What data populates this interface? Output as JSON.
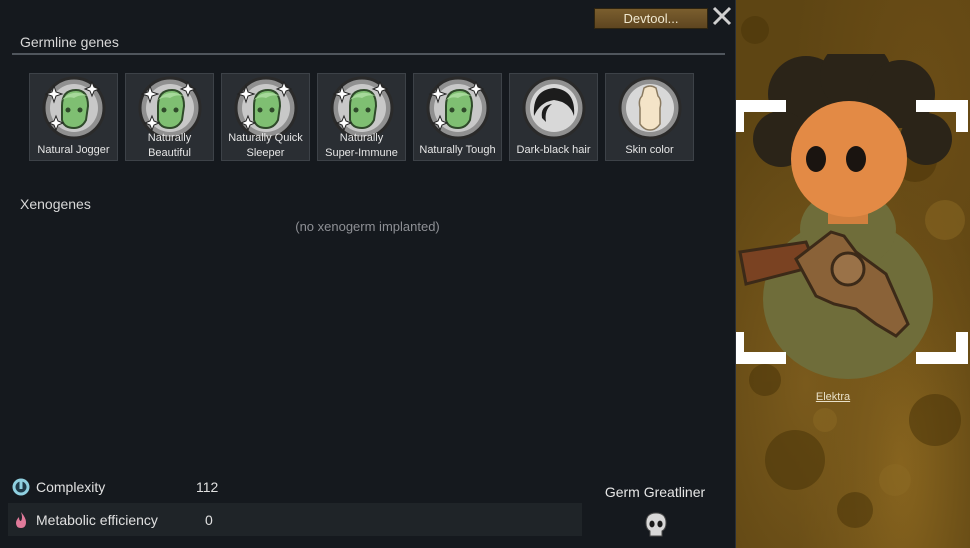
{
  "window": {
    "devtool_label": "Devtool...",
    "germline_title": "Germline genes",
    "xenogenes_title": "Xenogenes",
    "xenogenes_empty": "(no xenogerm implanted)"
  },
  "genes": [
    {
      "label": "Natural Jogger",
      "icon": "gene-head-icon"
    },
    {
      "label": "Naturally\nBeautiful",
      "icon": "gene-head-icon"
    },
    {
      "label": "Naturally Quick\nSleeper",
      "icon": "gene-head-icon"
    },
    {
      "label": "Naturally\nSuper-Immune",
      "icon": "gene-head-icon"
    },
    {
      "label": "Naturally Tough",
      "icon": "gene-head-icon"
    },
    {
      "label": "Dark-black hair",
      "icon": "hair-icon"
    },
    {
      "label": "Skin color",
      "icon": "skin-color-icon"
    }
  ],
  "stats": {
    "complexity_label": "Complexity",
    "complexity_value": "112",
    "metabolic_label": "Metabolic efficiency",
    "metabolic_value": "0"
  },
  "xenotype": {
    "name": "Germ Greatliner",
    "icon": "xenotype-skull-icon"
  },
  "pawn": {
    "name": "Elektra"
  },
  "colors": {
    "window_bg": "#15191e",
    "gene_icon_green": "#7fbf72",
    "devtool_brown": "#6b5126"
  }
}
